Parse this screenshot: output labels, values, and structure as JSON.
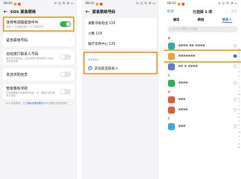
{
  "colors": {
    "accent": "#2c73d6",
    "toggle_on": "#2bb44a",
    "highlight": "#f0a433"
  },
  "status": {
    "time": "08:02",
    "icons": "⊙ ◫ ⇅ ◔ ▭"
  },
  "phone1": {
    "title": "SOS 紧急联络",
    "rows": [
      {
        "title": "连按电源键紧急呼叫",
        "sub": "连按 5 次电源键进行 SOS 紧急呼叫",
        "toggle": "on"
      },
      {
        "title": "紧急联络号码"
      },
      {
        "title": "自动拨打联系人号码",
        "sub": "紧急呼叫发起后，会自动拨打紧急联络人号码，并发送短信",
        "toggle": "off"
      },
      {
        "title": "发送求助信息",
        "toggle": "off"
      },
      {
        "title": "智能看板求助",
        "sub": "在智能看板中查看求助信息，可一键拨打紧急联络人电话",
        "toggle": "off"
      }
    ],
    "footnote_pre": "SOS 紧急联络，可在",
    "footnote_link": "隐私政策和联系人",
    "footnote_post": "中查看信息处理说明。"
  },
  "phone2": {
    "title": "紧急联络号码",
    "numbers": [
      "报警求助电话 110",
      "火警 119",
      "医疗急救中心 120"
    ],
    "section_label": "紧急联络人",
    "add_label": "添加紧急联系人"
  },
  "phone3": {
    "cancel": "取消",
    "title": "已选择 1 项",
    "ok": "确定",
    "tabs": [
      "通话",
      "群组",
      "联系人"
    ],
    "search_placeholder": "在 10 个联系人中搜索",
    "groups": [
      {
        "letter": "B",
        "contacts": [
          {
            "name": "▪▪▪▪ ▪▪·▪▪▪▪",
            "color": "#2bb0a8"
          },
          {
            "name": "▪▪▪▪▪▪▪",
            "color": "#f0a433",
            "highlight": true
          },
          {
            "name": "▪▪ ▪ ▪▪▪▪",
            "color": "#5b7fd8"
          }
        ]
      },
      {
        "letter": "C",
        "contacts": [
          {
            "name": "▪▪▪▪",
            "color": "#2bb44a"
          }
        ]
      },
      {
        "letter": "D",
        "contacts": [
          {
            "name": "▪▪▪",
            "color": "#e25b3c"
          },
          {
            "name": "▪▪▪▪",
            "color": "#e25b3c"
          }
        ]
      },
      {
        "letter": "F",
        "contacts": [
          {
            "name": "▪▪▪",
            "color": "#3fa7e8"
          }
        ]
      }
    ],
    "alphabet": [
      "A",
      "B",
      "C",
      "D",
      "E",
      "F",
      "G",
      "H",
      "I",
      "J",
      "K",
      "L",
      "M",
      "N",
      "O",
      "P",
      "Q",
      "R",
      "S",
      "T",
      "U",
      "V",
      "W",
      "X",
      "Y",
      "Z",
      "#"
    ]
  }
}
